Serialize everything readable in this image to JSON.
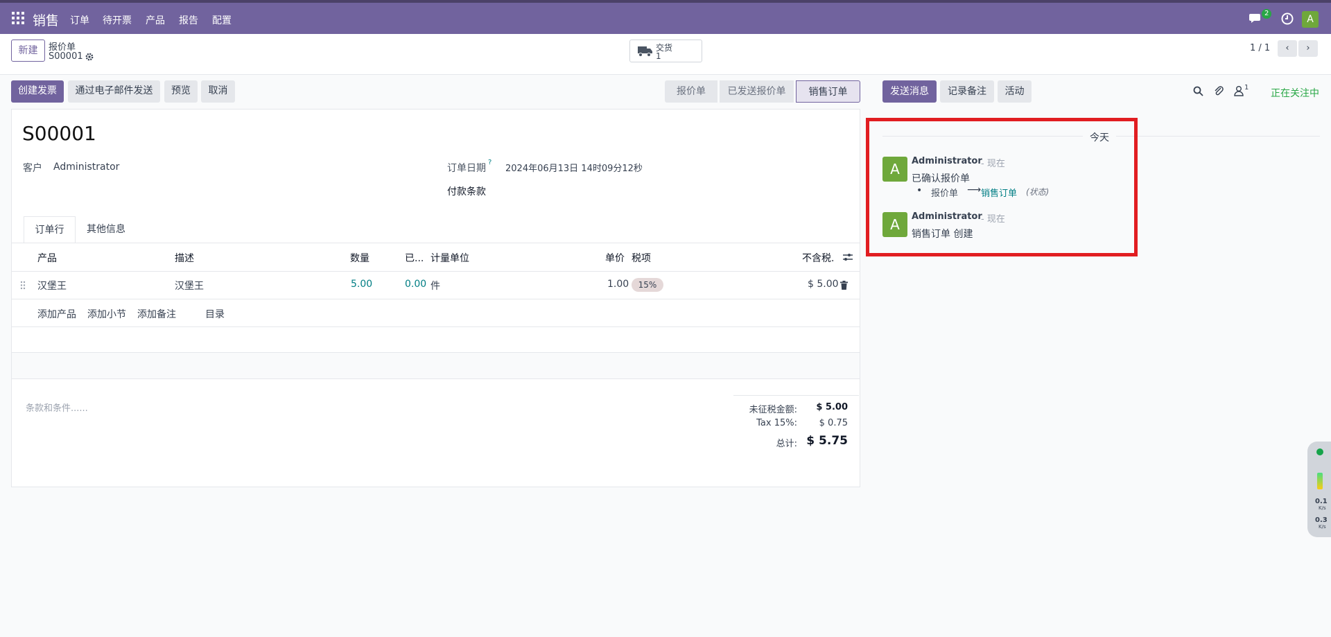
{
  "topbar": {
    "app_name": "销售",
    "menu": [
      "订单",
      "待开票",
      "产品",
      "报告",
      "配置"
    ],
    "chat_count": "2",
    "user_initial": "A"
  },
  "control_panel": {
    "new_label": "新建",
    "breadcrumb_parent": "报价单",
    "breadcrumb_current": "S00001",
    "delivery_label": "交货",
    "delivery_count": "1",
    "pager": "1 / 1"
  },
  "actions": {
    "create_invoice": "创建发票",
    "send_email": "通过电子邮件发送",
    "preview": "预览",
    "cancel": "取消"
  },
  "statusbar": [
    "报价单",
    "已发送报价单",
    "销售订单"
  ],
  "form": {
    "name": "S00001",
    "customer_label": "客户",
    "customer_value": "Administrator",
    "order_date_label": "订单日期",
    "order_date_help": "?",
    "order_date_value": "2024年06月13日 14时09分12秒",
    "payment_terms_label": "付款条款"
  },
  "tabs": [
    "订单行",
    "其他信息"
  ],
  "table": {
    "headers": [
      "产品",
      "描述",
      "数量",
      "已...",
      "计量单位",
      "单价",
      "税项",
      "不含税."
    ],
    "row": {
      "product": "汉堡王",
      "description": "汉堡王",
      "quantity": "5.00",
      "delivered": "0.00",
      "uom": "件",
      "price": "1.00",
      "tax": "15%",
      "subtotal": "$ 5.00"
    },
    "add_links": [
      "添加产品",
      "添加小节",
      "添加备注",
      "目录"
    ]
  },
  "terms_placeholder": "条款和条件......",
  "totals": {
    "untaxed_label": "未征税金额:",
    "untaxed_value": "$ 5.00",
    "tax_label": "Tax 15%:",
    "tax_value": "$ 0.75",
    "total_label": "总计:",
    "total_value": "$ 5.75"
  },
  "chatter": {
    "send_message": "发送消息",
    "log_note": "记录备注",
    "activity": "活动",
    "followers_count": "1",
    "following": "正在关注中",
    "date_separator": "今天",
    "messages": [
      {
        "author": "Administrator",
        "when": "- 现在",
        "body": "已确认报价单",
        "change_from": "报价单",
        "change_to": "销售订单",
        "change_field": "(状态)"
      },
      {
        "author": "Administrator",
        "when": "- 现在",
        "body": "销售订单 创建"
      }
    ]
  },
  "side_widget": {
    "up": "0.1",
    "up_unit": "K/s",
    "down": "0.3",
    "down_unit": "K/s"
  }
}
